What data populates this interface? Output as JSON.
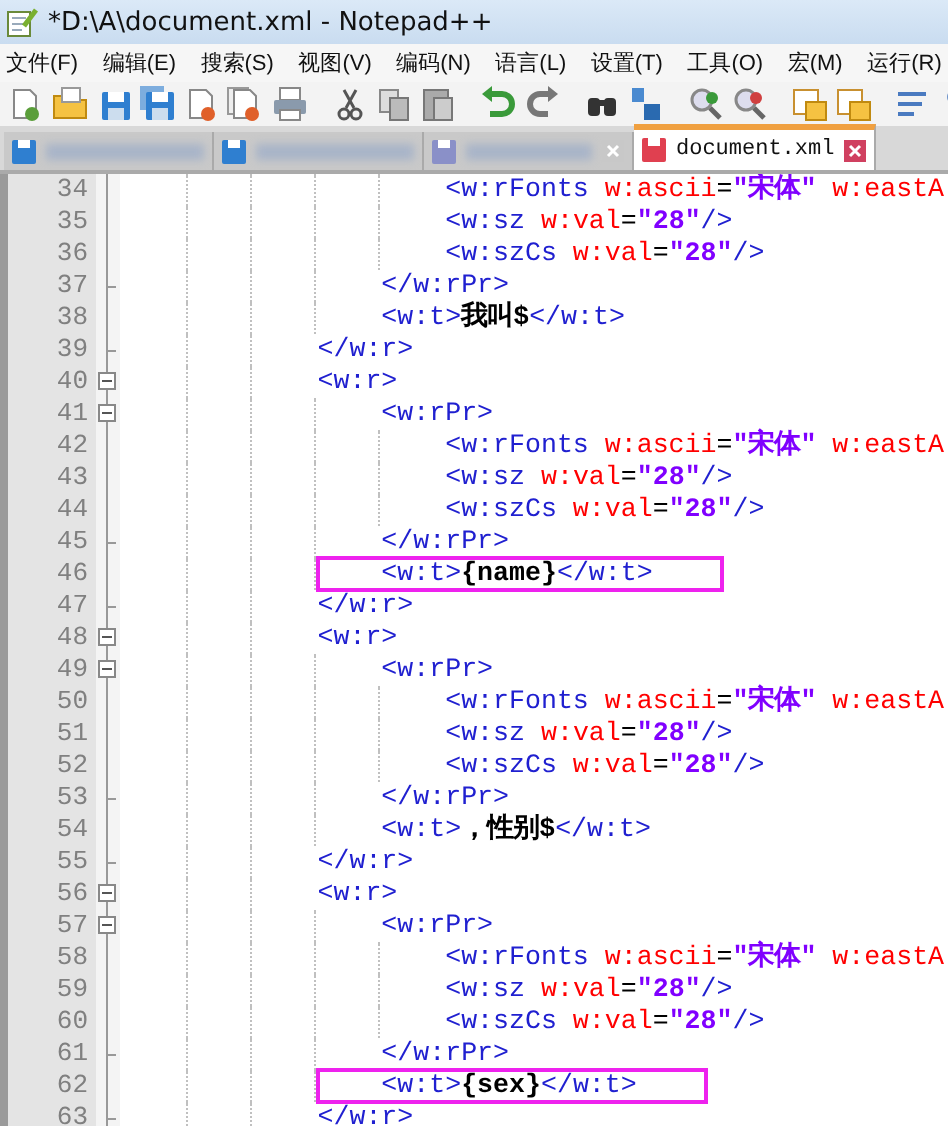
{
  "window": {
    "title": "*D:\\A\\document.xml - Notepad++"
  },
  "menu": [
    "文件(F)",
    "编辑(E)",
    "搜索(S)",
    "视图(V)",
    "编码(N)",
    "语言(L)",
    "设置(T)",
    "工具(O)",
    "宏(M)",
    "运行(R)"
  ],
  "tabs": [
    {
      "selected": false,
      "saved": true
    },
    {
      "selected": false,
      "saved": true
    },
    {
      "selected": false,
      "saved": false
    },
    {
      "label": "document.xml",
      "selected": true,
      "saved": false
    }
  ],
  "editor": {
    "lines": [
      {
        "number": "34",
        "kind": "plain",
        "boxed": false,
        "tokens": [
          {
            "kind": "tag",
            "text": "                    <w:rFonts"
          },
          {
            "kind": "attr",
            "text": " w:ascii"
          },
          {
            "kind": "sym",
            "text": "="
          },
          {
            "kind": "value",
            "text": "\"宋体\""
          },
          {
            "kind": "attr",
            "text": " w:eastA"
          }
        ]
      },
      {
        "number": "35",
        "kind": "plain",
        "boxed": false,
        "tokens": [
          {
            "kind": "tag",
            "text": "                    <w:sz"
          },
          {
            "kind": "attr",
            "text": " w:val"
          },
          {
            "kind": "sym",
            "text": "="
          },
          {
            "kind": "value",
            "text": "\"28\""
          },
          {
            "kind": "tag",
            "text": "/>"
          }
        ]
      },
      {
        "number": "36",
        "kind": "plain",
        "boxed": false,
        "tokens": [
          {
            "kind": "tag",
            "text": "                    <w:szCs"
          },
          {
            "kind": "attr",
            "text": " w:val"
          },
          {
            "kind": "sym",
            "text": "="
          },
          {
            "kind": "value",
            "text": "\"28\""
          },
          {
            "kind": "tag",
            "text": "/>"
          }
        ]
      },
      {
        "number": "37",
        "kind": "fold-end",
        "boxed": false,
        "tokens": [
          {
            "kind": "tag",
            "text": "                </w:rPr>"
          }
        ]
      },
      {
        "number": "38",
        "kind": "plain",
        "boxed": false,
        "tokens": [
          {
            "kind": "tag",
            "text": "                <w:t>"
          },
          {
            "kind": "text",
            "text": "我叫$"
          },
          {
            "kind": "tag",
            "text": "</w:t>"
          }
        ]
      },
      {
        "number": "39",
        "kind": "fold-end",
        "boxed": false,
        "tokens": [
          {
            "kind": "tag",
            "text": "            </w:r>"
          }
        ]
      },
      {
        "number": "40",
        "kind": "fold-start",
        "boxed": false,
        "tokens": [
          {
            "kind": "tag",
            "text": "            <w:r>"
          }
        ]
      },
      {
        "number": "41",
        "kind": "fold-start",
        "boxed": false,
        "tokens": [
          {
            "kind": "tag",
            "text": "                <w:rPr>"
          }
        ]
      },
      {
        "number": "42",
        "kind": "plain",
        "boxed": false,
        "tokens": [
          {
            "kind": "tag",
            "text": "                    <w:rFonts"
          },
          {
            "kind": "attr",
            "text": " w:ascii"
          },
          {
            "kind": "sym",
            "text": "="
          },
          {
            "kind": "value",
            "text": "\"宋体\""
          },
          {
            "kind": "attr",
            "text": " w:eastA"
          }
        ]
      },
      {
        "number": "43",
        "kind": "plain",
        "boxed": false,
        "tokens": [
          {
            "kind": "tag",
            "text": "                    <w:sz"
          },
          {
            "kind": "attr",
            "text": " w:val"
          },
          {
            "kind": "sym",
            "text": "="
          },
          {
            "kind": "value",
            "text": "\"28\""
          },
          {
            "kind": "tag",
            "text": "/>"
          }
        ]
      },
      {
        "number": "44",
        "kind": "plain",
        "boxed": false,
        "tokens": [
          {
            "kind": "tag",
            "text": "                    <w:szCs"
          },
          {
            "kind": "attr",
            "text": " w:val"
          },
          {
            "kind": "sym",
            "text": "="
          },
          {
            "kind": "value",
            "text": "\"28\""
          },
          {
            "kind": "tag",
            "text": "/>"
          }
        ]
      },
      {
        "number": "45",
        "kind": "fold-end",
        "boxed": false,
        "tokens": [
          {
            "kind": "tag",
            "text": "                </w:rPr>"
          }
        ]
      },
      {
        "number": "46",
        "kind": "plain",
        "boxed": true,
        "tokens": [
          {
            "kind": "tag",
            "text": "                <w:t>"
          },
          {
            "kind": "text",
            "text": "{name}"
          },
          {
            "kind": "tag",
            "text": "</w:t>"
          }
        ]
      },
      {
        "number": "47",
        "kind": "fold-end",
        "boxed": false,
        "tokens": [
          {
            "kind": "tag",
            "text": "            </w:r>"
          }
        ]
      },
      {
        "number": "48",
        "kind": "fold-start",
        "boxed": false,
        "tokens": [
          {
            "kind": "tag",
            "text": "            <w:r>"
          }
        ]
      },
      {
        "number": "49",
        "kind": "fold-start",
        "boxed": false,
        "tokens": [
          {
            "kind": "tag",
            "text": "                <w:rPr>"
          }
        ]
      },
      {
        "number": "50",
        "kind": "plain",
        "boxed": false,
        "tokens": [
          {
            "kind": "tag",
            "text": "                    <w:rFonts"
          },
          {
            "kind": "attr",
            "text": " w:ascii"
          },
          {
            "kind": "sym",
            "text": "="
          },
          {
            "kind": "value",
            "text": "\"宋体\""
          },
          {
            "kind": "attr",
            "text": " w:eastA"
          }
        ]
      },
      {
        "number": "51",
        "kind": "plain",
        "boxed": false,
        "tokens": [
          {
            "kind": "tag",
            "text": "                    <w:sz"
          },
          {
            "kind": "attr",
            "text": " w:val"
          },
          {
            "kind": "sym",
            "text": "="
          },
          {
            "kind": "value",
            "text": "\"28\""
          },
          {
            "kind": "tag",
            "text": "/>"
          }
        ]
      },
      {
        "number": "52",
        "kind": "plain",
        "boxed": false,
        "tokens": [
          {
            "kind": "tag",
            "text": "                    <w:szCs"
          },
          {
            "kind": "attr",
            "text": " w:val"
          },
          {
            "kind": "sym",
            "text": "="
          },
          {
            "kind": "value",
            "text": "\"28\""
          },
          {
            "kind": "tag",
            "text": "/>"
          }
        ]
      },
      {
        "number": "53",
        "kind": "fold-end",
        "boxed": false,
        "tokens": [
          {
            "kind": "tag",
            "text": "                </w:rPr>"
          }
        ]
      },
      {
        "number": "54",
        "kind": "plain",
        "boxed": false,
        "tokens": [
          {
            "kind": "tag",
            "text": "                <w:t>"
          },
          {
            "kind": "text",
            "text": "，性别$"
          },
          {
            "kind": "tag",
            "text": "</w:t>"
          }
        ]
      },
      {
        "number": "55",
        "kind": "fold-end",
        "boxed": false,
        "tokens": [
          {
            "kind": "tag",
            "text": "            </w:r>"
          }
        ]
      },
      {
        "number": "56",
        "kind": "fold-start",
        "boxed": false,
        "tokens": [
          {
            "kind": "tag",
            "text": "            <w:r>"
          }
        ]
      },
      {
        "number": "57",
        "kind": "fold-start",
        "boxed": false,
        "tokens": [
          {
            "kind": "tag",
            "text": "                <w:rPr>"
          }
        ]
      },
      {
        "number": "58",
        "kind": "plain",
        "boxed": false,
        "tokens": [
          {
            "kind": "tag",
            "text": "                    <w:rFonts"
          },
          {
            "kind": "attr",
            "text": " w:ascii"
          },
          {
            "kind": "sym",
            "text": "="
          },
          {
            "kind": "value",
            "text": "\"宋体\""
          },
          {
            "kind": "attr",
            "text": " w:eastA"
          }
        ]
      },
      {
        "number": "59",
        "kind": "plain",
        "boxed": false,
        "tokens": [
          {
            "kind": "tag",
            "text": "                    <w:sz"
          },
          {
            "kind": "attr",
            "text": " w:val"
          },
          {
            "kind": "sym",
            "text": "="
          },
          {
            "kind": "value",
            "text": "\"28\""
          },
          {
            "kind": "tag",
            "text": "/>"
          }
        ]
      },
      {
        "number": "60",
        "kind": "plain",
        "boxed": false,
        "tokens": [
          {
            "kind": "tag",
            "text": "                    <w:szCs"
          },
          {
            "kind": "attr",
            "text": " w:val"
          },
          {
            "kind": "sym",
            "text": "="
          },
          {
            "kind": "value",
            "text": "\"28\""
          },
          {
            "kind": "tag",
            "text": "/>"
          }
        ]
      },
      {
        "number": "61",
        "kind": "fold-end",
        "boxed": false,
        "tokens": [
          {
            "kind": "tag",
            "text": "                </w:rPr>"
          }
        ]
      },
      {
        "number": "62",
        "kind": "plain",
        "boxed": true,
        "tokens": [
          {
            "kind": "tag",
            "text": "                <w:t>"
          },
          {
            "kind": "text",
            "text": "{sex}"
          },
          {
            "kind": "tag",
            "text": "</w:t>"
          }
        ]
      },
      {
        "number": "63",
        "kind": "fold-end",
        "boxed": false,
        "tokens": [
          {
            "kind": "tag",
            "text": "            </w:r>"
          }
        ]
      }
    ]
  }
}
